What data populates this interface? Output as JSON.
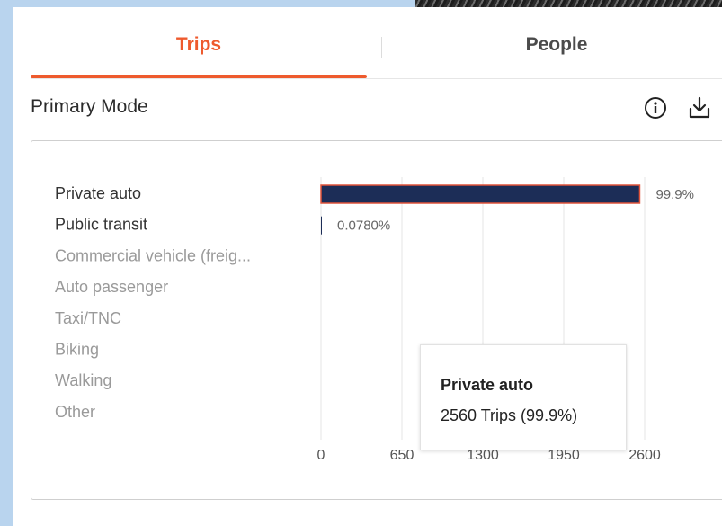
{
  "tabs": {
    "trips_label": "Trips",
    "people_label": "People",
    "active": "Trips"
  },
  "section": {
    "title": "Primary Mode"
  },
  "icons": {
    "info": "info-icon",
    "download": "download-icon"
  },
  "colors": {
    "accent": "#ee5a2d",
    "bar": "#1c2d57",
    "bar_border": "#e0533a",
    "label_strong": "#333333",
    "label_muted": "#9a9a9a"
  },
  "tooltip": {
    "title": "Private auto",
    "value": "2560 Trips (99.9%)"
  },
  "chart_data": {
    "type": "bar",
    "orientation": "horizontal",
    "categories": [
      "Private auto",
      "Public transit",
      "Commercial vehicle (freig...",
      "Auto passenger",
      "Taxi/TNC",
      "Biking",
      "Walking",
      "Other"
    ],
    "values": [
      2560,
      2,
      0,
      0,
      0,
      0,
      0,
      0
    ],
    "value_labels": [
      "99.9%",
      "0.0780%",
      "",
      "",
      "",
      "",
      "",
      ""
    ],
    "xlim": [
      0,
      2600
    ],
    "xticks": [
      "0",
      "650",
      "1300",
      "1950",
      "2600"
    ],
    "grid": true,
    "highlighted_category": "Private auto"
  }
}
